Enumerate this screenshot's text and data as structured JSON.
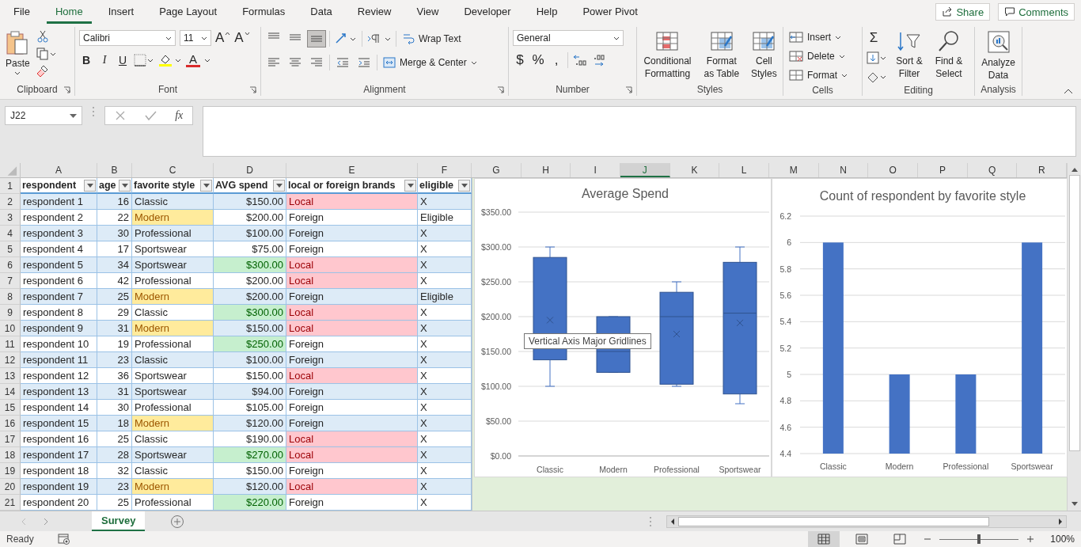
{
  "menu_tabs": [
    {
      "label": "File",
      "selected": false
    },
    {
      "label": "Home",
      "selected": true
    },
    {
      "label": "Insert",
      "selected": false
    },
    {
      "label": "Page Layout",
      "selected": false
    },
    {
      "label": "Formulas",
      "selected": false
    },
    {
      "label": "Data",
      "selected": false
    },
    {
      "label": "Review",
      "selected": false
    },
    {
      "label": "View",
      "selected": false
    },
    {
      "label": "Developer",
      "selected": false
    },
    {
      "label": "Help",
      "selected": false
    },
    {
      "label": "Power Pivot",
      "selected": false
    }
  ],
  "share_button": "Share",
  "comments_button": "Comments",
  "ribbon": {
    "clipboard": {
      "paste": "Paste",
      "label": "Clipboard"
    },
    "font": {
      "name": "Calibri",
      "size": "11",
      "grow": "A",
      "shrink": "A",
      "format_buttons": [
        "B",
        "I",
        "U"
      ],
      "font_color": "A",
      "label": "Font"
    },
    "alignment": {
      "vertical_align": [
        {
          "kind": "top",
          "selected": false
        },
        {
          "kind": "middle",
          "selected": false
        },
        {
          "kind": "bottom",
          "selected": true
        }
      ],
      "wrap_text": "Wrap Text",
      "merge_center": "Merge & Center",
      "label": "Alignment"
    },
    "number": {
      "format": "General",
      "symbols": [
        "$",
        "%",
        ","
      ],
      "label": "Number"
    },
    "styles": {
      "buttons": [
        "Conditional Formatting",
        "Format as Table",
        "Cell Styles"
      ],
      "label": "Styles"
    },
    "cells": {
      "buttons": [
        "Insert",
        "Delete",
        "Format"
      ],
      "label": "Cells"
    },
    "editing": {
      "sum": "Σ",
      "buttons": [
        "Sort & Filter",
        "Find & Select"
      ],
      "label": "Editing"
    },
    "analysis": {
      "button": "Analyze Data",
      "label": "Analysis"
    }
  },
  "formula_bar": {
    "name_box": "J22",
    "function": "fx"
  },
  "grid": {
    "column_letters": [
      {
        "label": "A",
        "selected": false
      },
      {
        "label": "B",
        "selected": false
      },
      {
        "label": "C",
        "selected": false
      },
      {
        "label": "D",
        "selected": false
      },
      {
        "label": "E",
        "selected": false
      },
      {
        "label": "F",
        "selected": false
      },
      {
        "label": "G",
        "selected": false
      },
      {
        "label": "H",
        "selected": false
      },
      {
        "label": "I",
        "selected": false
      },
      {
        "label": "J",
        "selected": true
      },
      {
        "label": "K",
        "selected": false
      },
      {
        "label": "L",
        "selected": false
      },
      {
        "label": "M",
        "selected": false
      },
      {
        "label": "N",
        "selected": false
      },
      {
        "label": "O",
        "selected": false
      },
      {
        "label": "P",
        "selected": false
      },
      {
        "label": "Q",
        "selected": false
      },
      {
        "label": "R",
        "selected": false
      }
    ],
    "row_numbers": [
      "1",
      "2",
      "3",
      "4",
      "5",
      "6",
      "7",
      "8",
      "9",
      "10",
      "11",
      "12",
      "13",
      "14",
      "15",
      "16",
      "17",
      "18",
      "19",
      "20",
      "21"
    ],
    "table": {
      "columns": [
        "respondent",
        "age",
        "favorite style",
        "AVG spend",
        "local or foreign brands",
        "eligible"
      ],
      "rows": [
        {
          "cells": [
            "respondent 1",
            "16",
            "Classic",
            "$150.00",
            "Local",
            "X"
          ],
          "highlighted": [
            false,
            false,
            true
          ]
        },
        {
          "cells": [
            "respondent 2",
            "22",
            "Modern",
            "$200.00",
            "Foreign",
            "Eligible"
          ],
          "highlighted": [
            true,
            false,
            false
          ]
        },
        {
          "cells": [
            "respondent 3",
            "30",
            "Professional",
            "$100.00",
            "Foreign",
            "X"
          ],
          "highlighted": [
            false,
            false,
            false
          ]
        },
        {
          "cells": [
            "respondent 4",
            "17",
            "Sportswear",
            "$75.00",
            "Foreign",
            "X"
          ],
          "highlighted": [
            false,
            false,
            false
          ]
        },
        {
          "cells": [
            "respondent 5",
            "34",
            "Sportswear",
            "$300.00",
            "Local",
            "X"
          ],
          "highlighted": [
            false,
            true,
            true
          ]
        },
        {
          "cells": [
            "respondent 6",
            "42",
            "Professional",
            "$200.00",
            "Local",
            "X"
          ],
          "highlighted": [
            false,
            false,
            true
          ]
        },
        {
          "cells": [
            "respondent 7",
            "25",
            "Modern",
            "$200.00",
            "Foreign",
            "Eligible"
          ],
          "highlighted": [
            true,
            false,
            false
          ]
        },
        {
          "cells": [
            "respondent 8",
            "29",
            "Classic",
            "$300.00",
            "Local",
            "X"
          ],
          "highlighted": [
            false,
            true,
            true
          ]
        },
        {
          "cells": [
            "respondent 9",
            "31",
            "Modern",
            "$150.00",
            "Local",
            "X"
          ],
          "highlighted": [
            true,
            false,
            true
          ]
        },
        {
          "cells": [
            "respondent 10",
            "19",
            "Professional",
            "$250.00",
            "Foreign",
            "X"
          ],
          "highlighted": [
            false,
            true,
            false
          ]
        },
        {
          "cells": [
            "respondent 11",
            "23",
            "Classic",
            "$100.00",
            "Foreign",
            "X"
          ],
          "highlighted": [
            false,
            false,
            false
          ]
        },
        {
          "cells": [
            "respondent 12",
            "36",
            "Sportswear",
            "$150.00",
            "Local",
            "X"
          ],
          "highlighted": [
            false,
            false,
            true
          ]
        },
        {
          "cells": [
            "respondent 13",
            "31",
            "Sportswear",
            "$94.00",
            "Foreign",
            "X"
          ],
          "highlighted": [
            false,
            false,
            false
          ]
        },
        {
          "cells": [
            "respondent 14",
            "30",
            "Professional",
            "$105.00",
            "Foreign",
            "X"
          ],
          "highlighted": [
            false,
            false,
            false
          ]
        },
        {
          "cells": [
            "respondent 15",
            "18",
            "Modern",
            "$120.00",
            "Foreign",
            "X"
          ],
          "highlighted": [
            true,
            false,
            false
          ]
        },
        {
          "cells": [
            "respondent 16",
            "25",
            "Classic",
            "$190.00",
            "Local",
            "X"
          ],
          "highlighted": [
            false,
            false,
            true
          ]
        },
        {
          "cells": [
            "respondent 17",
            "28",
            "Sportswear",
            "$270.00",
            "Local",
            "X"
          ],
          "highlighted": [
            false,
            true,
            true
          ]
        },
        {
          "cells": [
            "respondent 18",
            "32",
            "Classic",
            "$150.00",
            "Foreign",
            "X"
          ],
          "highlighted": [
            false,
            false,
            false
          ]
        },
        {
          "cells": [
            "respondent 19",
            "23",
            "Modern",
            "$120.00",
            "Local",
            "X"
          ],
          "highlighted": [
            true,
            false,
            true
          ]
        },
        {
          "cells": [
            "respondent 20",
            "25",
            "Professional",
            "$220.00",
            "Foreign",
            "X"
          ],
          "highlighted": [
            false,
            true,
            false
          ]
        }
      ]
    }
  },
  "charts": [
    {
      "chart_data": {
        "type": "box",
        "title": "Average Spend",
        "categories": [
          "Classic",
          "Modern",
          "Professional",
          "Sportswear"
        ],
        "color": "#4472c4",
        "grid": true,
        "boxes": [
          {
            "low": 100,
            "q1": 138,
            "median": 170,
            "q3": 285,
            "high": 300,
            "mean": 195
          },
          {
            "low": 120,
            "q1": 120,
            "median": 150,
            "q3": 200,
            "high": 200,
            "mean": 158
          },
          {
            "low": 100,
            "q1": 103,
            "median": 200,
            "q3": 235,
            "high": 250,
            "mean": 175
          },
          {
            "low": 75,
            "q1": 89,
            "median": 205,
            "q3": 278,
            "high": 300,
            "mean": 191
          }
        ],
        "ylim": [
          0,
          350
        ],
        "yticks": [
          {
            "value": 0,
            "label": "$0.00"
          },
          {
            "value": 50,
            "label": "$50.00"
          },
          {
            "value": 100,
            "label": "$100.00"
          },
          {
            "value": 150,
            "label": "$150.00"
          },
          {
            "value": 200,
            "label": "$200.00"
          },
          {
            "value": 250,
            "label": "$250.00"
          },
          {
            "value": 300,
            "label": "$300.00"
          },
          {
            "value": 350,
            "label": "$350.00"
          }
        ]
      },
      "tooltip": "Vertical Axis Major Gridlines"
    },
    {
      "chart_data": {
        "type": "bar",
        "title": "Count of respondent by favorite style",
        "categories": [
          "Classic",
          "Modern",
          "Professional",
          "Sportswear"
        ],
        "values": [
          6,
          5,
          5,
          6
        ],
        "grid": true,
        "ylim": [
          4.4,
          6.2
        ],
        "yticks": [
          {
            "value": 4.4,
            "label": "4.4"
          },
          {
            "value": 4.6,
            "label": "4.6"
          },
          {
            "value": 4.8,
            "label": "4.8"
          },
          {
            "value": 5,
            "label": "5"
          },
          {
            "value": 5.2,
            "label": "5.2"
          },
          {
            "value": 5.4,
            "label": "5.4"
          },
          {
            "value": 5.6,
            "label": "5.6"
          },
          {
            "value": 5.8,
            "label": "5.8"
          },
          {
            "value": 6,
            "label": "6"
          },
          {
            "value": 6.2,
            "label": "6.2"
          }
        ]
      }
    }
  ],
  "sheet_tabs": [
    {
      "label": "Survey",
      "selected": true
    }
  ],
  "status_bar": {
    "status": "Ready",
    "views": [
      {
        "kind": "normal",
        "selected": true
      },
      {
        "kind": "page-layout",
        "selected": false
      },
      {
        "kind": "page-break",
        "selected": false
      }
    ],
    "zoom_slider": {
      "level": 0.5
    },
    "zoom": "100%"
  }
}
